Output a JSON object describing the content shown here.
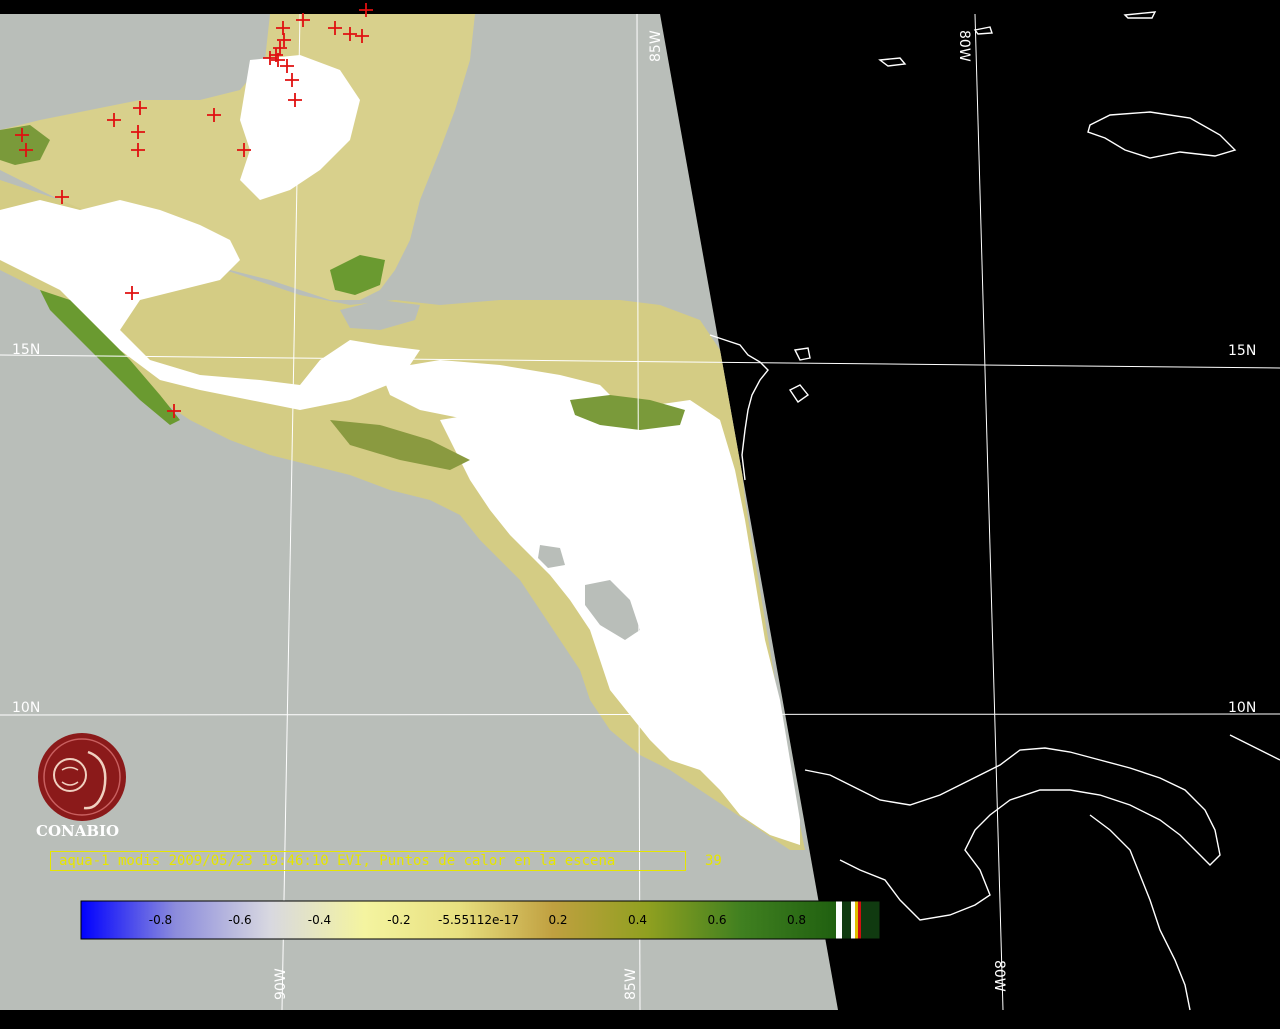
{
  "map": {
    "caption": "aqua-1 modis 2009/05/23 19:46:10 EVI, Puntos de calor en la escena",
    "hotspot_count": "39",
    "organization": "CONABIO",
    "logo": "conabio-logo",
    "latitude_labels": [
      "15N",
      "15N",
      "10N",
      "10N"
    ],
    "longitude_labels": [
      "90W",
      "85W",
      "85W",
      "80W",
      "80W"
    ],
    "colors": {
      "background": "#000000",
      "no_data": "#b9beb9",
      "cloud": "#ffffff",
      "grid": "#ffffff",
      "coastline": "#ffffff",
      "hotspot": "#e01010",
      "caption": "#e6e600",
      "logo": "#8b1a1a"
    }
  },
  "colorbar": {
    "ticks": [
      "-0.8",
      "-0.6",
      "-0.4",
      "-0.2",
      "-5.55112e-17",
      "0.2",
      "0.4",
      "0.6",
      "0.8"
    ],
    "stops": [
      "#0000ff",
      "#8c8cdc",
      "#d8d8e0",
      "#f4f4a0",
      "#e8e080",
      "#c0a040",
      "#90a020",
      "#408020",
      "#206010"
    ],
    "range": [
      -1,
      1
    ]
  }
}
